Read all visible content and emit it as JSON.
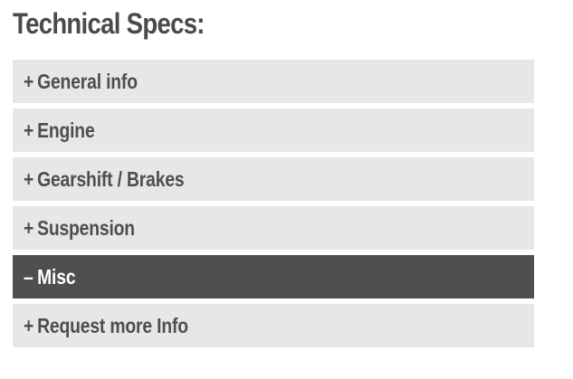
{
  "heading": "Technical Specs:",
  "sections": [
    {
      "sign": "+",
      "label": "General info",
      "expanded": false
    },
    {
      "sign": "+",
      "label": "Engine",
      "expanded": false
    },
    {
      "sign": "+",
      "label": "Gearshift / Brakes",
      "expanded": false
    },
    {
      "sign": "+",
      "label": "Suspension",
      "expanded": false
    },
    {
      "sign": "–",
      "label": "Misc",
      "expanded": true
    },
    {
      "sign": "+",
      "label": "Request more Info",
      "expanded": false
    }
  ],
  "colors": {
    "heading": "#4a4a4a",
    "collapsed_bg": "#e7e7e7",
    "collapsed_text": "#4e4e4e",
    "expanded_bg": "#4f4f4f",
    "expanded_text": "#ffffff"
  }
}
